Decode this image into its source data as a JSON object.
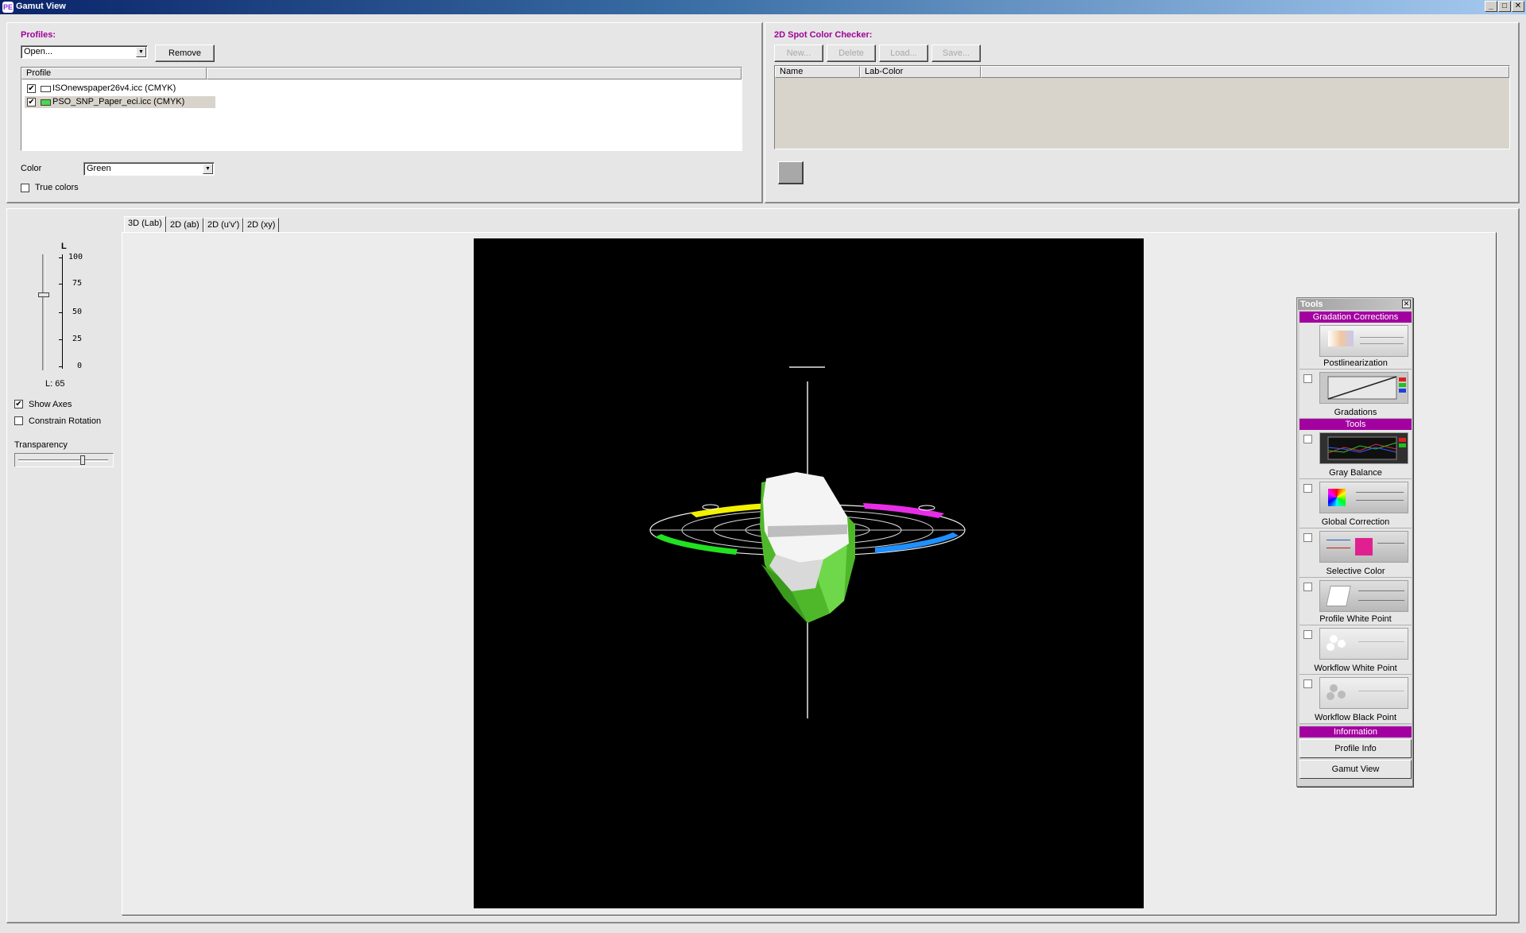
{
  "window": {
    "title": "Gamut View",
    "app_icon": "PE"
  },
  "window_controls": {
    "minimize": "_",
    "maximize": "□",
    "close": "✕"
  },
  "profiles_panel": {
    "title": "Profiles:",
    "open_combo_value": "Open...",
    "remove_button": "Remove",
    "list_header": "Profile",
    "items": [
      {
        "name": "ISOnewspaper26v4.icc (CMYK)",
        "checked": true,
        "swatch_color": "#ffffff"
      },
      {
        "name": "PSO_SNP_Paper_eci.icc (CMYK)",
        "checked": true,
        "swatch_color": "#4ad94a"
      }
    ],
    "color_label": "Color",
    "color_value": "Green",
    "true_colors_label": "True colors",
    "true_colors_checked": false
  },
  "spot_panel": {
    "title": "2D Spot Color Checker:",
    "buttons": {
      "new": "New...",
      "delete": "Delete",
      "load": "Load...",
      "save": "Save..."
    },
    "columns": {
      "name": "Name",
      "lab": "Lab-Color"
    },
    "swatch_color": "#a8a8a8"
  },
  "left_controls": {
    "slider_title": "L",
    "ticks": [
      "100",
      "75",
      "50",
      "25",
      "0"
    ],
    "l_value": "L: 65",
    "l_level": 65,
    "show_axes_label": "Show Axes",
    "show_axes_checked": true,
    "constrain_label": "Constrain Rotation",
    "constrain_checked": false,
    "transparency_label": "Transparency"
  },
  "tabs": [
    "3D (Lab)",
    "2D (ab)",
    "2D (u'v')",
    "2D (xy)"
  ],
  "active_tab": 0,
  "tools": {
    "title": "Tools",
    "categories": {
      "gradation": "Gradation Corrections",
      "tools": "Tools",
      "information": "Information"
    },
    "items": {
      "postlinearization": "Postlinearization",
      "gradations": "Gradations",
      "gray_balance": "Gray Balance",
      "global_correction": "Global Correction",
      "selective_color": "Selective Color",
      "profile_white_point": "Profile White Point",
      "workflow_white_point": "Workflow White Point",
      "workflow_black_point": "Workflow Black Point"
    },
    "profile_info_button": "Profile Info",
    "gamut_view_button": "Gamut View"
  },
  "colors": {
    "section_title": "#a0009a",
    "tool_category": "#a300a0",
    "viewport_bg": "#000000",
    "gamut_green": "#5fcf3a",
    "gamut_white": "#f2f2f2"
  }
}
